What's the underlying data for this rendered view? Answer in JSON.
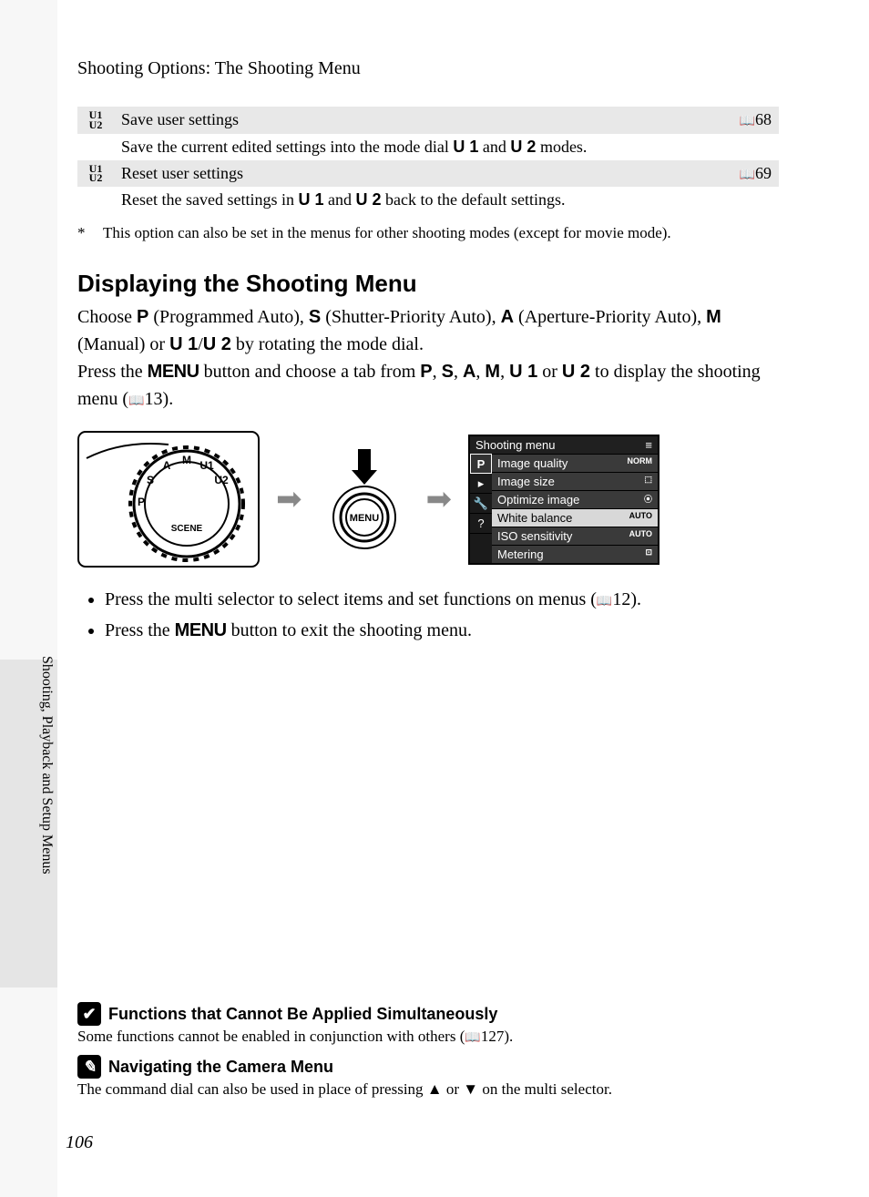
{
  "section_title": "Shooting Options: The Shooting Menu",
  "side_label": "Shooting, Playback and Setup Menus",
  "page_number": "106",
  "table": {
    "rows": [
      {
        "icon": "U1\nU2",
        "title": "Save user settings",
        "ref": "68",
        "desc_pre": "Save the current edited settings into the mode dial ",
        "desc_mid": " and ",
        "desc_post": " modes.",
        "u1": "U 1",
        "u2": "U 2"
      },
      {
        "icon": "U1\nU2",
        "title": "Reset user settings",
        "ref": "69",
        "desc_pre": "Reset the saved settings in ",
        "desc_mid": " and ",
        "desc_post": " back to the default settings.",
        "u1": "U 1",
        "u2": "U 2"
      }
    ]
  },
  "footnote": "This option can also be set in the menus for other shooting modes (except for movie mode).",
  "subheading": "Displaying the Shooting Menu",
  "para1": {
    "t1": "Choose ",
    "p": "P",
    "t2": " (Programmed Auto), ",
    "s": "S",
    "t3": " (Shutter-Priority Auto), ",
    "a": "A",
    "t4": " (Aperture-Priority Auto), ",
    "m": "M",
    "t5": " (Manual) or ",
    "u1": "U 1",
    "slash": "/",
    "u2": "U 2",
    "t6": " by rotating the mode dial."
  },
  "para2": {
    "t1": "Press the ",
    "menu": "MENU",
    "t2": " button and choose a tab from ",
    "p": "P",
    "c1": ", ",
    "s": "S",
    "c2": ", ",
    "a": "A",
    "c3": ", ",
    "m": "M",
    "c4": ", ",
    "u1": "U 1",
    "or": " or ",
    "u2": "U 2",
    "t3": " to display the shooting menu (",
    "ref": "13",
    "t4": ")."
  },
  "bullets": [
    {
      "t1": "Press the multi selector to select items and set functions on menus (",
      "ref": "12",
      "t2": ")."
    },
    {
      "t1": "Press the ",
      "menu": "MENU",
      "t2": " button to exit the shooting menu."
    }
  ],
  "notes": {
    "n1_title": "Functions that Cannot Be Applied Simultaneously",
    "n1_body_a": "Some functions cannot be enabled in conjunction with others (",
    "n1_ref": "127",
    "n1_body_b": ").",
    "n2_title": "Navigating the Camera Menu",
    "n2_body": "The command dial can also be used in place of pressing ▲ or ▼ on the multi selector."
  },
  "menuscreen": {
    "title": "Shooting menu",
    "items": [
      {
        "label": "Image quality",
        "val": "NORM"
      },
      {
        "label": "Image size",
        "val": "⬚"
      },
      {
        "label": "Optimize image",
        "val": "⦿"
      },
      {
        "label": "White balance",
        "val": "AUTO",
        "sel": true
      },
      {
        "label": "ISO sensitivity",
        "val": "AUTO"
      },
      {
        "label": "Metering",
        "val": "⊡"
      }
    ],
    "tabs": [
      "P",
      "▸",
      "🔧",
      "?"
    ]
  },
  "menu_button_label": "MENU"
}
